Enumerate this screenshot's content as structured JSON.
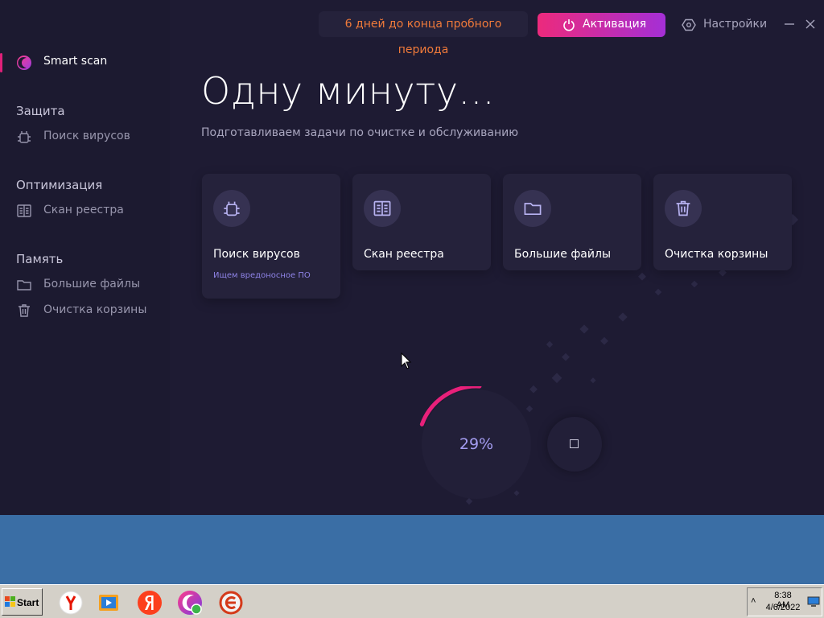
{
  "app": {
    "sidebar": {
      "active_item": {
        "label": "Smart scan",
        "icon": "app-logo-icon"
      },
      "sections": [
        {
          "title": "Защита",
          "items": [
            {
              "label": "Поиск вирусов",
              "icon": "bug-icon"
            }
          ]
        },
        {
          "title": "Оптимизация",
          "items": [
            {
              "label": "Скан реестра",
              "icon": "registry-book-icon"
            }
          ]
        },
        {
          "title": "Память",
          "items": [
            {
              "label": "Большие файлы",
              "icon": "folder-icon"
            },
            {
              "label": "Очистка корзины",
              "icon": "trash-icon"
            }
          ]
        }
      ]
    },
    "topbar": {
      "trial_text": "6 дней до конца пробного периода",
      "activate_label": "Активация",
      "settings_label": "Настройки"
    },
    "main": {
      "heading": "Одну минуту...",
      "subheading": "Подготавливаем задачи по очистке и обслуживанию",
      "cards": [
        {
          "title": "Поиск вирусов",
          "status": "Ищем вредоносное ПО",
          "icon": "bug-icon"
        },
        {
          "title": "Скан реестра",
          "status": "",
          "icon": "registry-book-icon"
        },
        {
          "title": "Большие файлы",
          "status": "",
          "icon": "folder-icon"
        },
        {
          "title": "Очистка корзины",
          "status": "",
          "icon": "trash-icon"
        }
      ],
      "progress": {
        "percent_label": "29%",
        "value": 0.29
      }
    },
    "colors": {
      "accent": "#e8207a",
      "activate_gradient_start": "#ec2a7c",
      "activate_gradient_end": "#a42fd6",
      "trial_text": "#f07a3a",
      "background": "#1e1b33"
    }
  },
  "taskbar": {
    "start_label": "Start",
    "apps": [
      "yandex-browser-icon",
      "media-player-icon",
      "yandex-icon",
      "cleaner-app-icon",
      "browser-e-icon"
    ],
    "clock": {
      "time": "8:38 AM",
      "date": "4/6/2022"
    }
  }
}
